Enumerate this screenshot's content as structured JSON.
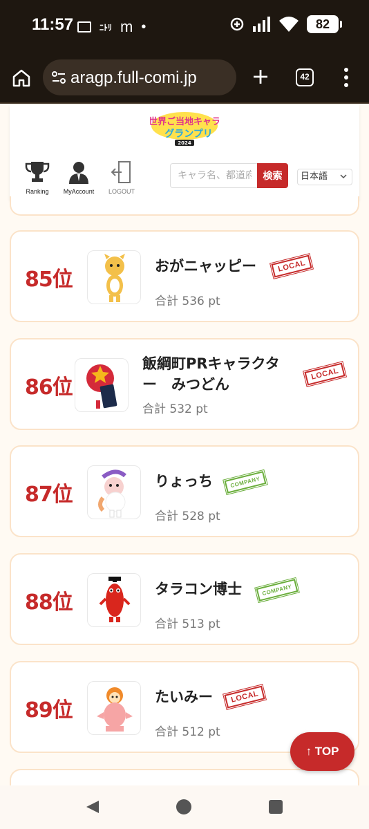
{
  "status_bar": {
    "time": "11:57",
    "app_icons": [
      "au-icon",
      "nitori-icon",
      "m-icon"
    ],
    "m_label": "m",
    "nitori_label": "ﾆﾄﾘ",
    "battery": "82"
  },
  "browser": {
    "url": "aragp.full-comi.jp",
    "tab_count": "42"
  },
  "header": {
    "logo_text": "世界ご当地キャラグランプリ",
    "logo_year": "2024",
    "nav": {
      "ranking": "Ranking",
      "account": "MyAccount",
      "logout": "LOGOUT"
    },
    "search": {
      "placeholder": "キャラ名、都道府県",
      "button": "検索"
    },
    "language": "日本語"
  },
  "ranking": [
    {
      "rank": "85位",
      "name_line1": "おがニャッピー",
      "name_line2": "",
      "points": "合計 536 pt",
      "badge": "LOCAL"
    },
    {
      "rank": "86位",
      "name_line1": "飯綱町PRキャラクタ",
      "name_line2": "ー　みつどん",
      "points": "合計 532 pt",
      "badge": "LOCAL"
    },
    {
      "rank": "87位",
      "name_line1": "りょっち",
      "name_line2": "",
      "points": "合計 528 pt",
      "badge": "COMPANY"
    },
    {
      "rank": "88位",
      "name_line1": "タラコン博士",
      "name_line2": "",
      "points": "合計 513 pt",
      "badge": "COMPANY"
    },
    {
      "rank": "89位",
      "name_line1": "たいみー",
      "name_line2": "",
      "points": "合計 512 pt",
      "badge": "LOCAL"
    }
  ],
  "top_button": "↑ TOP"
}
